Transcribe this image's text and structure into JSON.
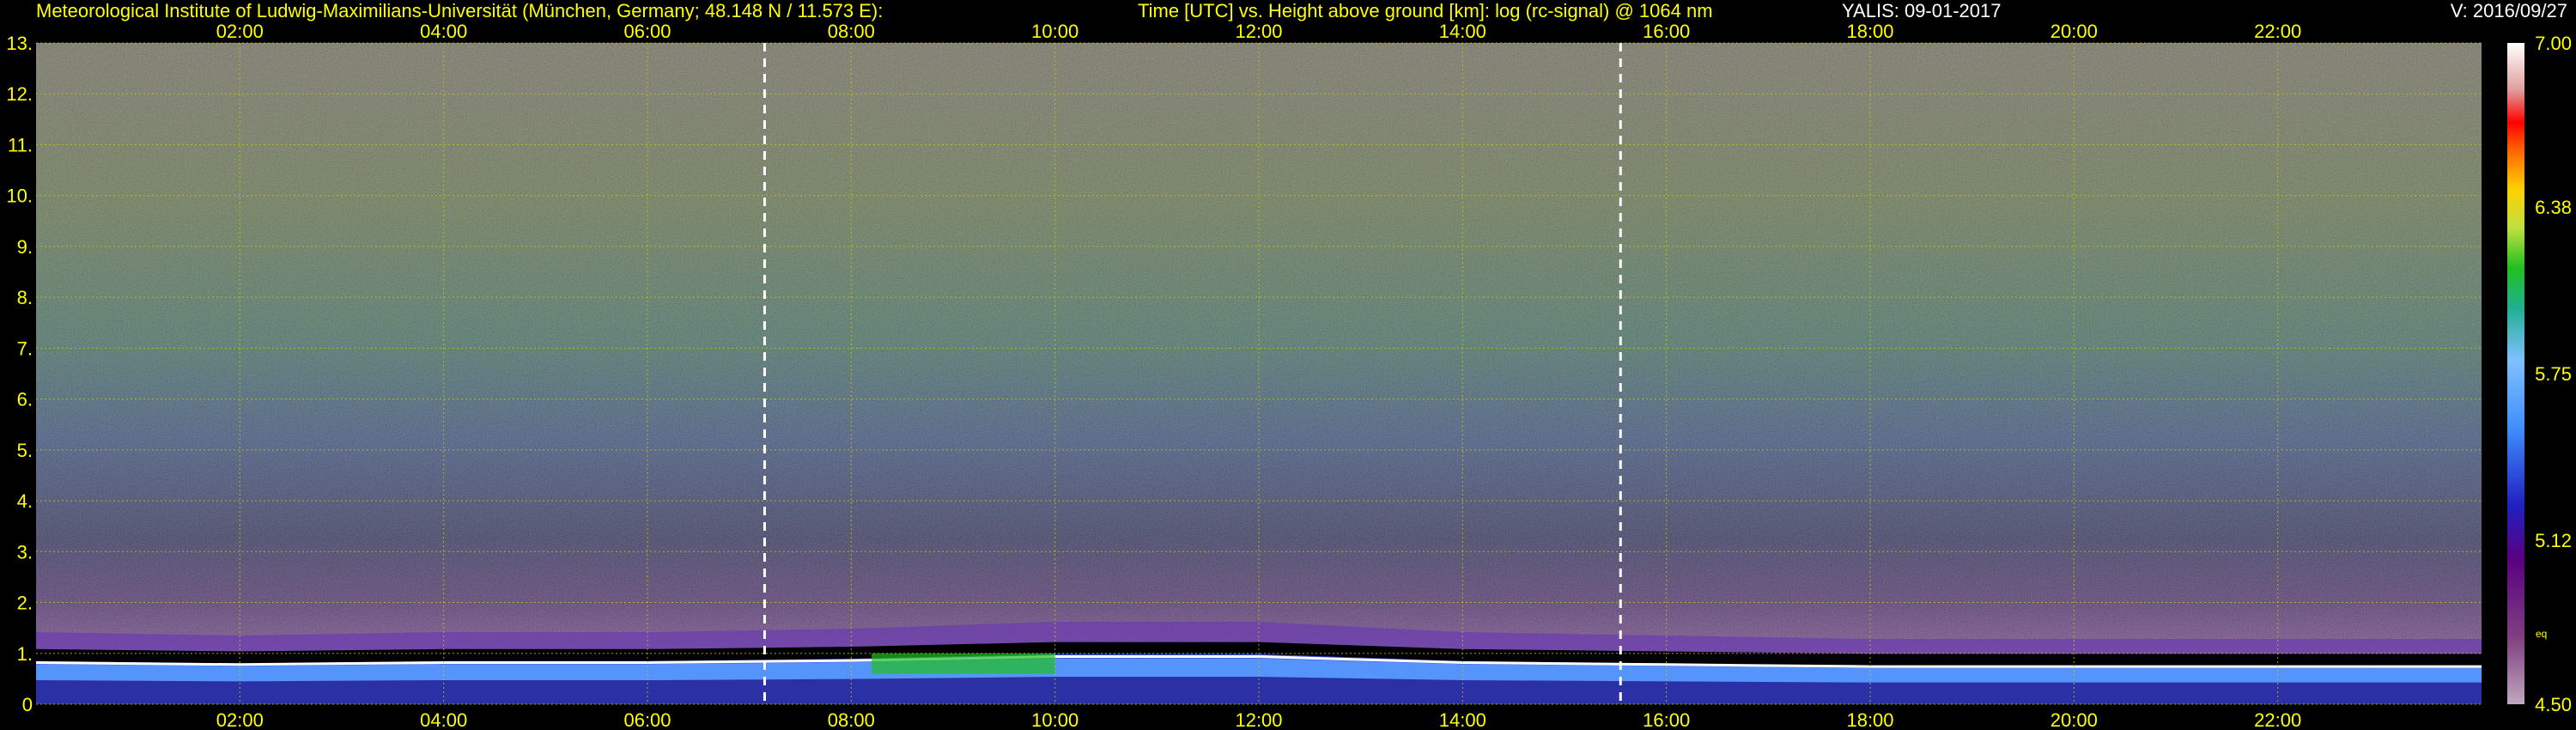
{
  "header": {
    "institute": "Meteorological Institute of Ludwig-Maximilians-Universität (München, Germany; 48.148 N / 11.573 E):",
    "description": "Time [UTC] vs. Height above ground [km]: log (rc-signal) @ 1064 nm",
    "instrument_date": "YALIS: 09-01-2017",
    "version": "V: 2016/09/27"
  },
  "chart_data": {
    "type": "heatmap",
    "x": {
      "label": "Time [UTC]",
      "range_hours": [
        0,
        24
      ],
      "ticks": [
        "02:00",
        "04:00",
        "06:00",
        "08:00",
        "10:00",
        "12:00",
        "14:00",
        "16:00",
        "18:00",
        "20:00",
        "22:00"
      ],
      "tick_hours": [
        2,
        4,
        6,
        8,
        10,
        12,
        14,
        16,
        18,
        20,
        22
      ]
    },
    "y": {
      "label": "Height above ground [km]",
      "range_km": [
        0,
        13
      ],
      "ticks": [
        "0",
        "1.",
        "2.",
        "3.",
        "4.",
        "5.",
        "6.",
        "7.",
        "8.",
        "9.",
        "10.",
        "11.",
        "12.",
        "13."
      ],
      "tick_values": [
        0,
        1,
        2,
        3,
        4,
        5,
        6,
        7,
        8,
        9,
        10,
        11,
        12,
        13
      ]
    },
    "colorbar": {
      "range": [
        4.5,
        7.0
      ],
      "ticks": [
        "4.50",
        "5.12",
        "5.75",
        "6.38",
        "7.00"
      ],
      "tick_values": [
        4.5,
        5.12,
        5.75,
        6.38,
        7.0
      ],
      "note": "eq"
    },
    "markers_hours": [
      7.15,
      15.55
    ],
    "boundary_layer_km": [
      {
        "t": 0,
        "top": 1.05
      },
      {
        "t": 2,
        "top": 1.0
      },
      {
        "t": 4,
        "top": 1.05
      },
      {
        "t": 6,
        "top": 1.05
      },
      {
        "t": 8,
        "top": 1.1
      },
      {
        "t": 10,
        "top": 1.2
      },
      {
        "t": 12,
        "top": 1.2
      },
      {
        "t": 14,
        "top": 1.05
      },
      {
        "t": 16,
        "top": 1.0
      },
      {
        "t": 18,
        "top": 0.95
      },
      {
        "t": 20,
        "top": 0.95
      },
      {
        "t": 24,
        "top": 0.95
      }
    ],
    "grid": true
  },
  "colors": {
    "text": "#ffff00",
    "grid": "#c8c800",
    "background": "#000000"
  }
}
